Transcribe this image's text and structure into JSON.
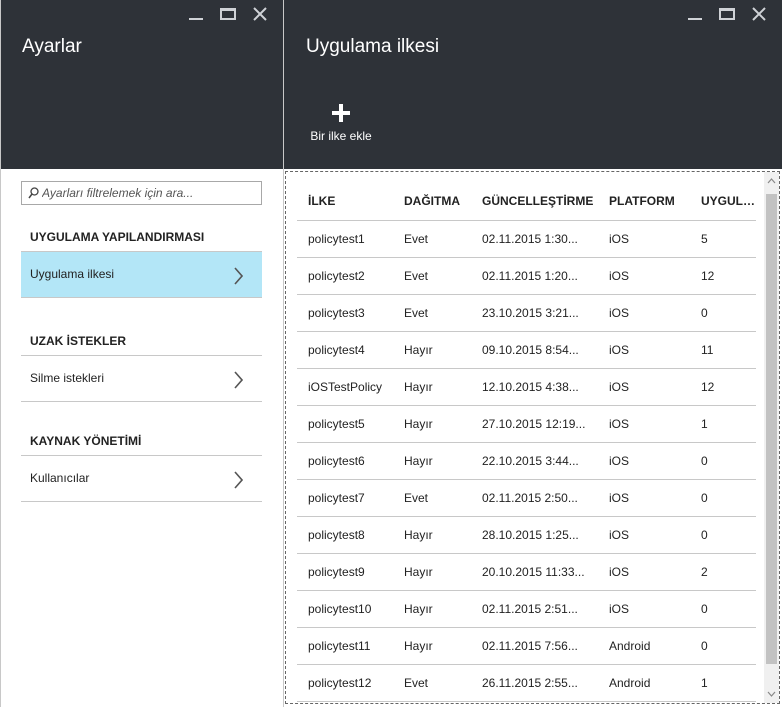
{
  "settings_blade": {
    "title": "Ayarlar",
    "search": {
      "placeholder": "Ayarları filtrelemek için ara...",
      "value": ""
    },
    "sections": [
      {
        "heading": "UYGULAMA YAPILANDIRMASI",
        "items": [
          {
            "label": "Uygulama ilkesi",
            "selected": true
          }
        ]
      },
      {
        "heading": "UZAK İSTEKLER",
        "items": [
          {
            "label": "Silme istekleri",
            "selected": false
          }
        ]
      },
      {
        "heading": "KAYNAK YÖNETİMİ",
        "items": [
          {
            "label": "Kullanıcılar",
            "selected": false
          }
        ]
      }
    ]
  },
  "policy_blade": {
    "title": "Uygulama ilkesi",
    "add_command_label": "Bir ilke ekle",
    "columns": [
      "İLKE",
      "DAĞITMA",
      "GÜNCELLEŞTİRME",
      "PLATFORM",
      "UYGULAMALAR"
    ],
    "rows": [
      [
        "policytest1",
        "Evet",
        "02.11.2015 1:30...",
        "iOS",
        "5"
      ],
      [
        "policytest2",
        "Evet",
        "02.11.2015 1:20...",
        "iOS",
        "12"
      ],
      [
        "policytest3",
        "Evet",
        "23.10.2015 3:21...",
        "iOS",
        "0"
      ],
      [
        "policytest4",
        "Hayır",
        "09.10.2015 8:54...",
        "iOS",
        "11"
      ],
      [
        "iOSTestPolicy",
        "Hayır",
        "12.10.2015 4:38...",
        "iOS",
        "12"
      ],
      [
        "policytest5",
        "Hayır",
        "27.10.2015 12:19...",
        "iOS",
        "1"
      ],
      [
        "policytest6",
        "Hayır",
        "22.10.2015 3:44...",
        "iOS",
        "0"
      ],
      [
        "policytest7",
        "Evet",
        "02.11.2015 2:50...",
        "iOS",
        "0"
      ],
      [
        "policytest8",
        "Hayır",
        "28.10.2015 1:25...",
        "iOS",
        "0"
      ],
      [
        "policytest9",
        "Hayır",
        "20.10.2015 11:33...",
        "iOS",
        "2"
      ],
      [
        "policytest10",
        "Hayır",
        "02.11.2015 2:51...",
        "iOS",
        "0"
      ],
      [
        "policytest11",
        "Hayır",
        "02.11.2015 7:56...",
        "Android",
        "0"
      ],
      [
        "policytest12",
        "Evet",
        "26.11.2015 2:55...",
        "Android",
        "1"
      ]
    ]
  },
  "colors": {
    "header_bg": "#2e3238",
    "selected_bg": "#b3e6f7",
    "divider": "#c8c8c8"
  },
  "icons": [
    "minimize-icon",
    "maximize-icon",
    "close-icon",
    "plus-icon",
    "search-icon",
    "chevron-right-icon",
    "scroll-up-icon",
    "scroll-down-icon"
  ]
}
